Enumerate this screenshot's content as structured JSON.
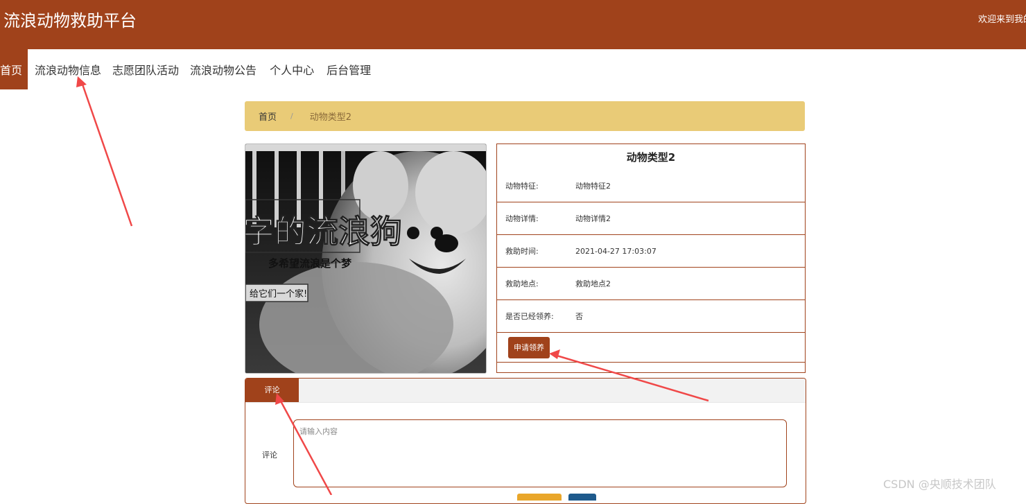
{
  "header": {
    "site_title": "流浪动物救助平台",
    "welcome_text": "欢迎来到我的"
  },
  "nav": {
    "items": [
      {
        "label": "首页",
        "active": true
      },
      {
        "label": "流浪动物信息",
        "active": false
      },
      {
        "label": "志愿团队活动",
        "active": false
      },
      {
        "label": "流浪动物公告",
        "active": false
      },
      {
        "label": "个人中心",
        "active": false
      },
      {
        "label": "后台管理",
        "active": false
      }
    ]
  },
  "breadcrumb": {
    "home": "首页",
    "separator": "/",
    "current": "动物类型2"
  },
  "photo": {
    "overlay_title": "字的流浪狗",
    "overlay_subtitle": "多希望流浪是个梦",
    "overlay_tag": "给它们一个家!"
  },
  "detail": {
    "title": "动物类型2",
    "rows": [
      {
        "label": "动物特征:",
        "value": "动物特征2"
      },
      {
        "label": "动物详情:",
        "value": "动物详情2"
      },
      {
        "label": "救助时间:",
        "value": "2021-04-27 17:03:07"
      },
      {
        "label": "救助地点:",
        "value": "救助地点2"
      },
      {
        "label": "是否已经领养:",
        "value": "否"
      }
    ],
    "apply_button": "申请领养"
  },
  "comments": {
    "tab_label": "评论",
    "field_label": "评论",
    "placeholder": "请输入内容"
  },
  "watermark": "CSDN @央顺技术团队",
  "colors": {
    "primary": "#a0421b",
    "breadcrumb_bg": "#e9cb77",
    "annotation_arrow": "#f04848"
  }
}
